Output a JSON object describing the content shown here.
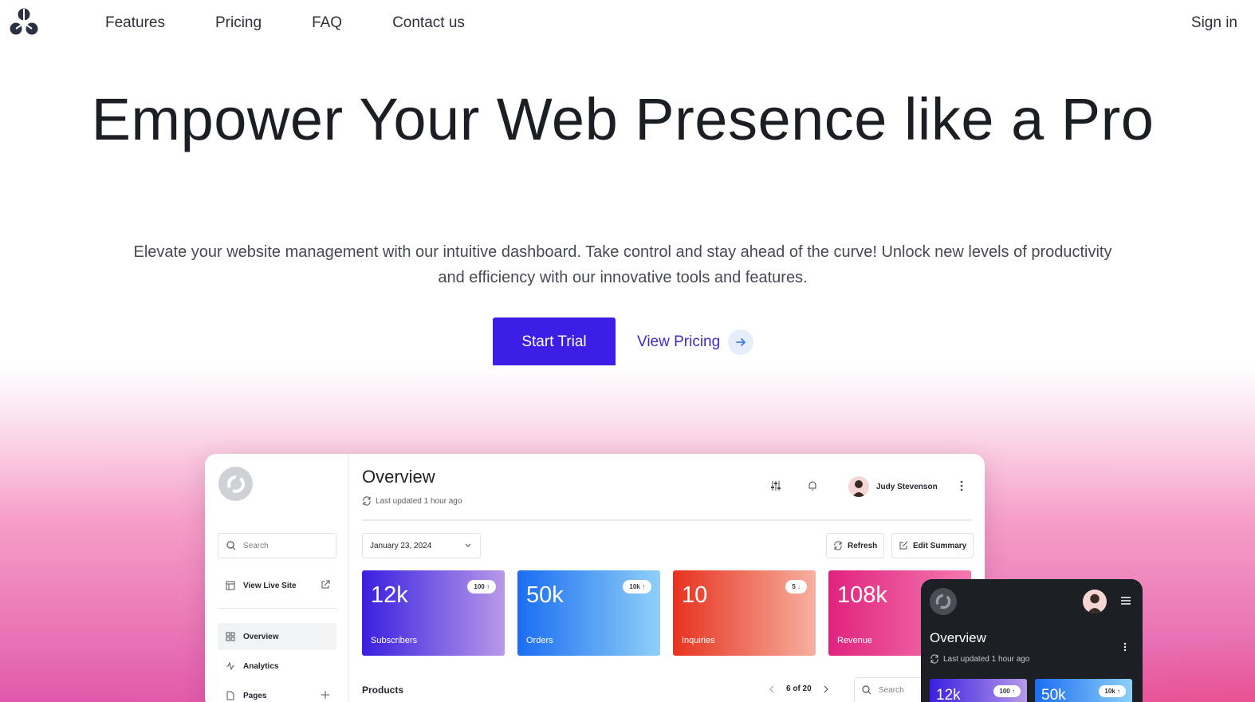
{
  "nav": {
    "links": [
      "Features",
      "Pricing",
      "FAQ",
      "Contact us"
    ],
    "sign_in": "Sign in"
  },
  "hero": {
    "title": "Empower Your Web Presence like a Pro",
    "subtitle": "Elevate your website management with our intuitive dashboard. Take control and stay ahead of the curve! Unlock new levels of productivity and efficiency with our innovative tools and features.",
    "primary_cta": "Start Trial",
    "secondary_cta": "View Pricing"
  },
  "dashboard": {
    "sidebar": {
      "search_placeholder": "Search",
      "view_live_site": "View Live Site",
      "items": [
        "Overview",
        "Analytics",
        "Pages"
      ]
    },
    "title": "Overview",
    "last_updated": "Last updated 1 hour ago",
    "user_name": "Judy Stevenson",
    "date": "January 23, 2024",
    "refresh": "Refresh",
    "edit_summary": "Edit Summary",
    "stats": [
      {
        "value": "12k",
        "label": "Subscribers",
        "badge": "100",
        "trend": "up",
        "color_from": "#3a1fe0",
        "color_to": "#b79ae8"
      },
      {
        "value": "50k",
        "label": "Orders",
        "badge": "10k",
        "trend": "up",
        "color_from": "#1a6df2",
        "color_to": "#8fd0f8"
      },
      {
        "value": "10",
        "label": "Inquiries",
        "badge": "5",
        "trend": "down",
        "color_from": "#e8321f",
        "color_to": "#f6b0a0"
      },
      {
        "value": "108k",
        "label": "Revenue",
        "badge": "",
        "trend": "up",
        "color_from": "#e0237f",
        "color_to": "#f57ab0"
      }
    ],
    "products_title": "Products",
    "pager": "6 of 20",
    "products_search": "Search"
  },
  "mobile": {
    "title": "Overview",
    "last_updated": "Last updated 1 hour ago",
    "stats": [
      {
        "value": "12k",
        "badge": "100"
      },
      {
        "value": "50k",
        "badge": "10k"
      }
    ]
  },
  "colors": {
    "primary": "#3d1ee6",
    "link": "#3d2bc9"
  }
}
